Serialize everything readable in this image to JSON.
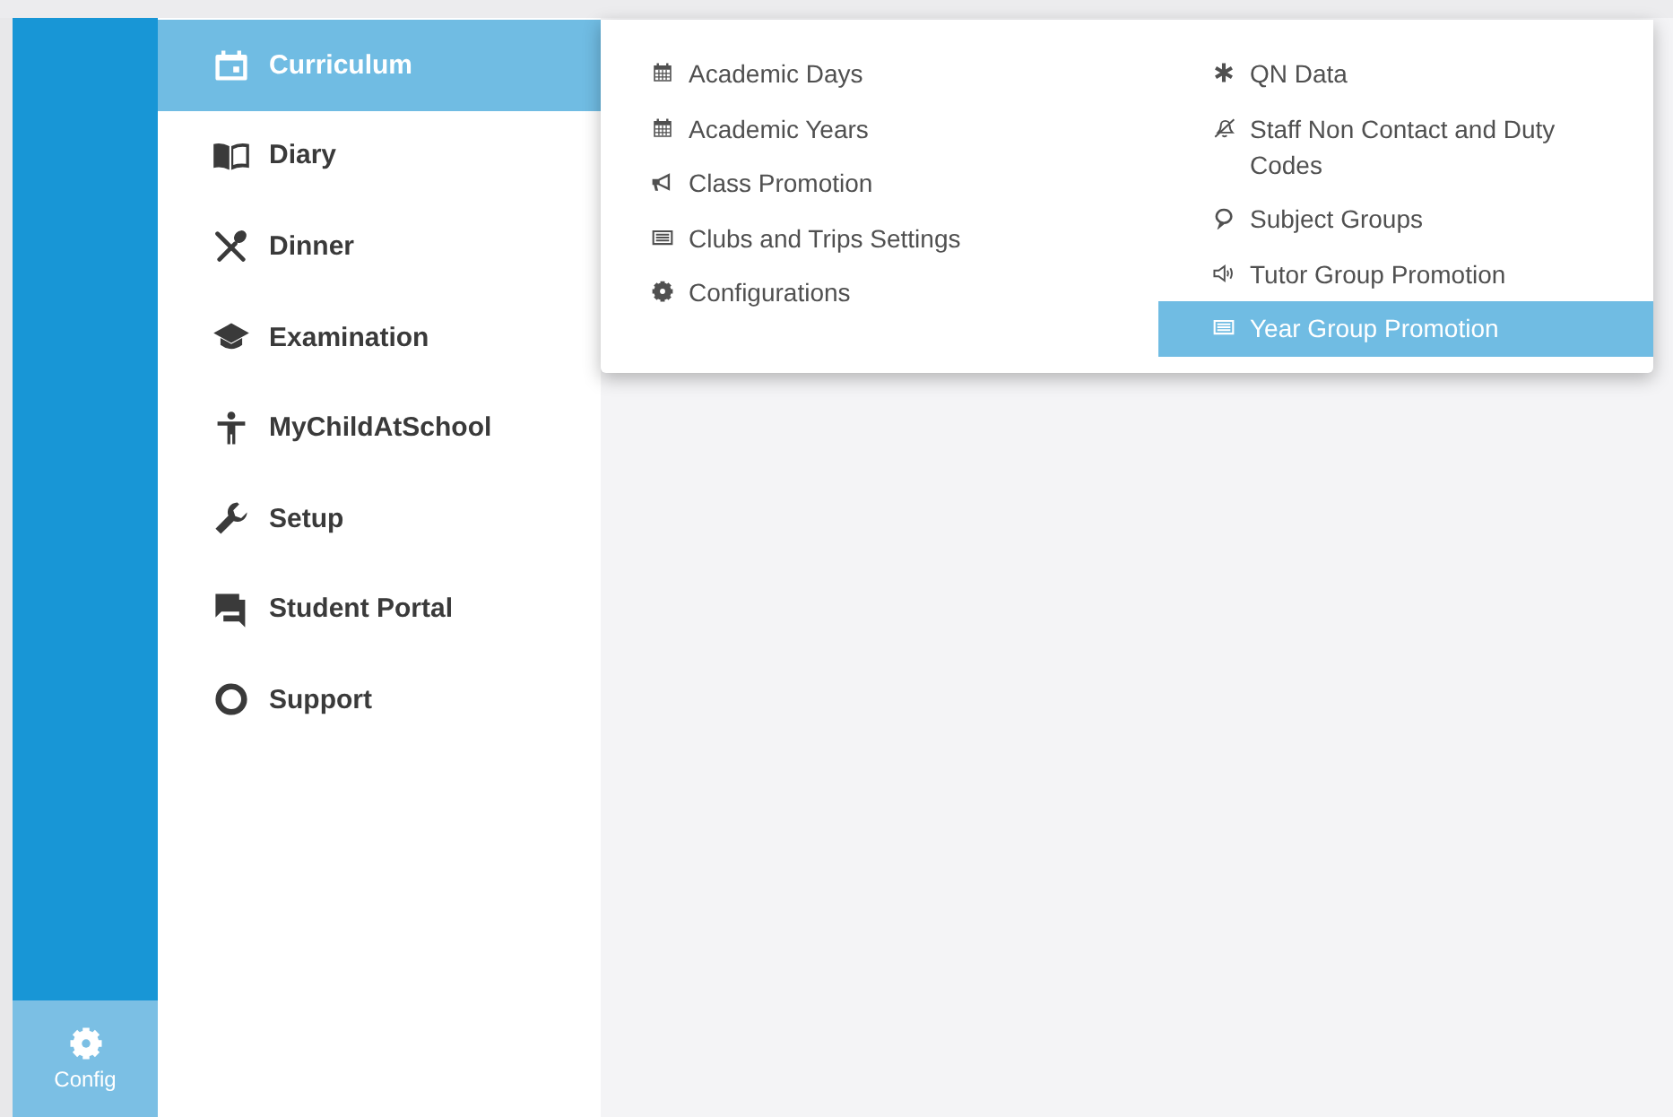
{
  "rail": {
    "items": [
      {
        "label": "Config",
        "selected": true
      }
    ]
  },
  "sidebar": {
    "items": [
      {
        "label": "Curriculum",
        "selected": true
      },
      {
        "label": "Diary",
        "selected": false
      },
      {
        "label": "Dinner",
        "selected": false
      },
      {
        "label": "Examination",
        "selected": false
      },
      {
        "label": "MyChildAtSchool",
        "selected": false
      },
      {
        "label": "Setup",
        "selected": false
      },
      {
        "label": "Student Portal",
        "selected": false
      },
      {
        "label": "Support",
        "selected": false
      }
    ]
  },
  "submenu": {
    "columns": [
      [
        {
          "label": "Academic Days",
          "selected": false
        },
        {
          "label": "Academic Years",
          "selected": false
        },
        {
          "label": "Class Promotion",
          "selected": false
        },
        {
          "label": "Clubs and Trips Settings",
          "selected": false
        },
        {
          "label": "Configurations",
          "selected": false
        }
      ],
      [
        {
          "label": "QN Data",
          "selected": false
        },
        {
          "label": "Staff Non Contact and Duty Codes",
          "selected": false
        },
        {
          "label": "Subject Groups",
          "selected": false
        },
        {
          "label": "Tutor Group Promotion",
          "selected": false
        },
        {
          "label": "Year Group Promotion",
          "selected": true
        }
      ]
    ]
  }
}
